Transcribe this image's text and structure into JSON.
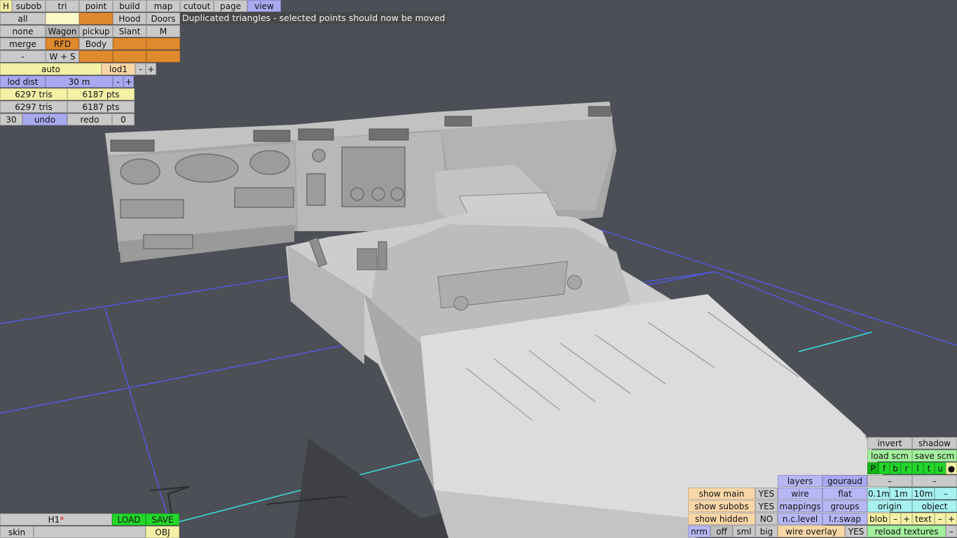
{
  "status_message": "Duplicated triangles - selected points should now be moved",
  "menu": {
    "h": "H",
    "subob": "subob",
    "tri": "tri",
    "point": "point",
    "build": "build",
    "map": "map",
    "cutout": "cutout",
    "page": "page",
    "view": "view"
  },
  "left": {
    "all": "all",
    "none": "none",
    "merge": "merge",
    "dash": "-",
    "hood": "Hood",
    "doors": "Doors",
    "wagon": "Wagon",
    "pickup": "pickup",
    "slant": "Slant",
    "m": "M",
    "rfd": "RFD",
    "body": "Body",
    "ws": "W + S",
    "auto": "auto",
    "lod1": "lod1",
    "minus": "-",
    "plus": "+",
    "lod_dist": "lod dist",
    "dist_value": "30 m",
    "tris1": "6297 tris",
    "pts1": "6187 pts",
    "tris2": "6297 tris",
    "pts2": "6187 pts",
    "n30": "30",
    "undo": "undo",
    "redo": "redo",
    "zero": "0"
  },
  "file": {
    "name": "H1",
    "modified_mark": "*",
    "load": "LOAD",
    "save": "SAVE",
    "skin": "skin",
    "obj": "OBJ"
  },
  "right": {
    "invert": "invert",
    "shadow": "shadow",
    "load_scm": "load scm",
    "save_scm": "save scm",
    "flags": [
      "P",
      "f",
      "b",
      "r",
      "l",
      "t",
      "u",
      "●"
    ],
    "layers": "layers",
    "gouraud": "gouraud",
    "dash1": "–",
    "dash2": "–",
    "show_main": "show main",
    "yes1": "YES",
    "wire": "wire",
    "flat": "flat",
    "d01": "0.1m",
    "d1": "1m",
    "d10": "10m",
    "dminus": "–",
    "show_subobs": "show subobs",
    "yes2": "YES",
    "mappings": "mappings",
    "groups": "groups",
    "origin": "origin",
    "object": "object",
    "show_hidden": "show hidden",
    "no": "NO",
    "nclevel": "n.c.level",
    "lrswap": "l.r.swap",
    "blob": "blob",
    "bminus": "–",
    "bplus": "+",
    "text": "text",
    "tminus": "–",
    "tplus": "+",
    "nrm": "nrm",
    "off": "off",
    "sml": "sml",
    "big": "big",
    "wire_overlay": "wire overlay",
    "yes3": "YES",
    "reload": "reload textures",
    "rminus": "–"
  },
  "colors": {
    "background": "#4c4f55",
    "grid": "#5b5cf0",
    "axis": "#38e0e0",
    "model": "#b9b9b9"
  }
}
